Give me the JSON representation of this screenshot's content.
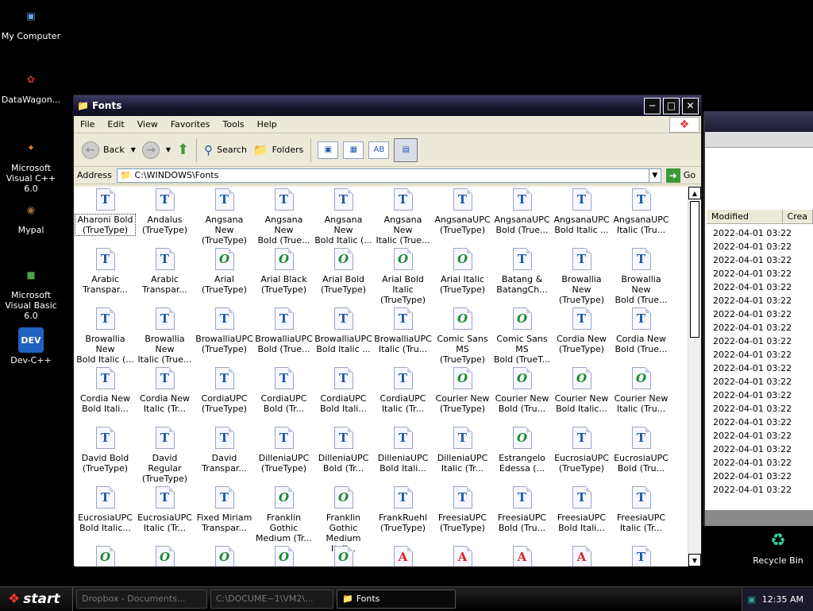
{
  "desktop": {
    "icons": [
      {
        "label": "My Computer",
        "glyph": "▣",
        "color": "#6aa0e0"
      },
      {
        "label": "DataWagon...",
        "glyph": "✿",
        "color": "#c03030"
      },
      {
        "label": "Microsoft Visual C++ 6.0",
        "glyph": "✦",
        "color": "#e08020"
      },
      {
        "label": "Mypal",
        "glyph": "◉",
        "color": "#a07040"
      },
      {
        "label": "Microsoft Visual Basic 6.0",
        "glyph": "■",
        "color": "#4aa04a"
      },
      {
        "label": "Dev-C++",
        "glyph": "DEV",
        "color": "#2060c0"
      }
    ],
    "recycle_bin": "Recycle Bin"
  },
  "background_window": {
    "columns": [
      "Modified",
      "Crea"
    ],
    "rows": [
      "2022-04-01 03:22",
      "2022-04-01 03:22",
      "2022-04-01 03:22",
      "2022-04-01 03:22",
      "2022-04-01 03:22",
      "2022-04-01 03:22",
      "2022-04-01 03:22",
      "2022-04-01 03:22",
      "2022-04-01 03:22",
      "2022-04-01 03:22",
      "2022-04-01 03:22",
      "2022-04-01 03:22",
      "2022-04-01 03:22",
      "2022-04-01 03:22",
      "2022-04-01 03:22",
      "2022-04-01 03:22",
      "2022-04-01 03:22",
      "2022-04-01 03:22",
      "2022-04-01 03:22",
      "2022-04-01 03:22"
    ]
  },
  "window": {
    "title": "Fonts",
    "menu": [
      "File",
      "Edit",
      "View",
      "Favorites",
      "Tools",
      "Help"
    ],
    "toolbar": {
      "back": "Back",
      "search": "Search",
      "folders": "Folders"
    },
    "address": {
      "label": "Address",
      "value": "C:\\WINDOWS\\Fonts",
      "go": "Go"
    }
  },
  "fonts": [
    {
      "l1": "Aharoni Bold",
      "l2": "(TrueType)",
      "type": "T"
    },
    {
      "l1": "Andalus",
      "l2": "(TrueType)",
      "type": "T"
    },
    {
      "l1": "Angsana New",
      "l2": "(TrueType)",
      "type": "T"
    },
    {
      "l1": "Angsana New",
      "l2": "Bold (True...",
      "type": "T"
    },
    {
      "l1": "Angsana New",
      "l2": "Bold Italic (...",
      "type": "T"
    },
    {
      "l1": "Angsana New",
      "l2": "Italic (True...",
      "type": "T"
    },
    {
      "l1": "AngsanaUPC",
      "l2": "(TrueType)",
      "type": "T"
    },
    {
      "l1": "AngsanaUPC",
      "l2": "Bold (True...",
      "type": "T"
    },
    {
      "l1": "AngsanaUPC",
      "l2": "Bold Italic ...",
      "type": "T"
    },
    {
      "l1": "AngsanaUPC",
      "l2": "Italic (Tru...",
      "type": "T"
    },
    {
      "l1": "Arabic",
      "l2": "Transpar...",
      "type": "T"
    },
    {
      "l1": "Arabic",
      "l2": "Transpar...",
      "type": "T"
    },
    {
      "l1": "Arial",
      "l2": "(TrueType)",
      "type": "O"
    },
    {
      "l1": "Arial Black",
      "l2": "(TrueType)",
      "type": "O"
    },
    {
      "l1": "Arial Bold",
      "l2": "(TrueType)",
      "type": "O"
    },
    {
      "l1": "Arial Bold Italic",
      "l2": "(TrueType)",
      "type": "O"
    },
    {
      "l1": "Arial Italic",
      "l2": "(TrueType)",
      "type": "O"
    },
    {
      "l1": "Batang &",
      "l2": "BatangCh...",
      "type": "T"
    },
    {
      "l1": "Browallia New",
      "l2": "(TrueType)",
      "type": "T"
    },
    {
      "l1": "Browallia New",
      "l2": "Bold (True...",
      "type": "T"
    },
    {
      "l1": "Browallia New",
      "l2": "Bold Italic (...",
      "type": "T"
    },
    {
      "l1": "Browallia New",
      "l2": "Italic (True...",
      "type": "T"
    },
    {
      "l1": "BrowalliaUPC",
      "l2": "(TrueType)",
      "type": "T"
    },
    {
      "l1": "BrowalliaUPC",
      "l2": "Bold (True...",
      "type": "T"
    },
    {
      "l1": "BrowalliaUPC",
      "l2": "Bold Italic ...",
      "type": "T"
    },
    {
      "l1": "BrowalliaUPC",
      "l2": "Italic (Tru...",
      "type": "T"
    },
    {
      "l1": "Comic Sans MS",
      "l2": "(TrueType)",
      "type": "O"
    },
    {
      "l1": "Comic Sans MS",
      "l2": "Bold (TrueT...",
      "type": "O"
    },
    {
      "l1": "Cordia New",
      "l2": "(TrueType)",
      "type": "T"
    },
    {
      "l1": "Cordia New",
      "l2": "Bold (True...",
      "type": "T"
    },
    {
      "l1": "Cordia New",
      "l2": "Bold Itali...",
      "type": "T"
    },
    {
      "l1": "Cordia New",
      "l2": "Italic (Tr...",
      "type": "T"
    },
    {
      "l1": "CordiaUPC",
      "l2": "(TrueType)",
      "type": "T"
    },
    {
      "l1": "CordiaUPC",
      "l2": "Bold (Tr...",
      "type": "T"
    },
    {
      "l1": "CordiaUPC",
      "l2": "Bold Itali...",
      "type": "T"
    },
    {
      "l1": "CordiaUPC",
      "l2": "Italic (Tr...",
      "type": "T"
    },
    {
      "l1": "Courier New",
      "l2": "(TrueType)",
      "type": "O"
    },
    {
      "l1": "Courier New",
      "l2": "Bold (Tru...",
      "type": "O"
    },
    {
      "l1": "Courier New",
      "l2": "Bold Italic...",
      "type": "O"
    },
    {
      "l1": "Courier New",
      "l2": "Italic (Tru...",
      "type": "O"
    },
    {
      "l1": "David Bold",
      "l2": "(TrueType)",
      "type": "T"
    },
    {
      "l1": "David Regular",
      "l2": "(TrueType)",
      "type": "T"
    },
    {
      "l1": "David",
      "l2": "Transpar...",
      "type": "T"
    },
    {
      "l1": "DilleniaUPC",
      "l2": "(TrueType)",
      "type": "T"
    },
    {
      "l1": "DilleniaUPC",
      "l2": "Bold (Tr...",
      "type": "T"
    },
    {
      "l1": "DilleniaUPC",
      "l2": "Bold Itali...",
      "type": "T"
    },
    {
      "l1": "DilleniaUPC",
      "l2": "Italic (Tr...",
      "type": "T"
    },
    {
      "l1": "Estrangelo",
      "l2": "Edessa (...",
      "type": "O"
    },
    {
      "l1": "EucrosiaUPC",
      "l2": "(TrueType)",
      "type": "T"
    },
    {
      "l1": "EucrosiaUPC",
      "l2": "Bold (Tru...",
      "type": "T"
    },
    {
      "l1": "EucrosiaUPC",
      "l2": "Bold Italic...",
      "type": "T"
    },
    {
      "l1": "EucrosiaUPC",
      "l2": "Italic (Tr...",
      "type": "T"
    },
    {
      "l1": "Fixed Miriam",
      "l2": "Transpar...",
      "type": "T"
    },
    {
      "l1": "Franklin Gothic",
      "l2": "Medium (Tr...",
      "type": "O"
    },
    {
      "l1": "Franklin Gothic",
      "l2": "Medium Itali...",
      "type": "O"
    },
    {
      "l1": "FrankRuehl",
      "l2": "(TrueType)",
      "type": "T"
    },
    {
      "l1": "FreesiaUPC",
      "l2": "(TrueType)",
      "type": "T"
    },
    {
      "l1": "FreesiaUPC",
      "l2": "Bold (Tru...",
      "type": "T"
    },
    {
      "l1": "FreesiaUPC",
      "l2": "Bold Itali...",
      "type": "T"
    },
    {
      "l1": "FreesiaUPC",
      "l2": "Italic (Tr...",
      "type": "T"
    },
    {
      "l1": "",
      "l2": "",
      "type": "O"
    },
    {
      "l1": "",
      "l2": "",
      "type": "O"
    },
    {
      "l1": "",
      "l2": "",
      "type": "O"
    },
    {
      "l1": "",
      "l2": "",
      "type": "O"
    },
    {
      "l1": "",
      "l2": "",
      "type": "O"
    },
    {
      "l1": "",
      "l2": "",
      "type": "A"
    },
    {
      "l1": "",
      "l2": "",
      "type": "A"
    },
    {
      "l1": "",
      "l2": "",
      "type": "A"
    },
    {
      "l1": "",
      "l2": "",
      "type": "A"
    },
    {
      "l1": "",
      "l2": "",
      "type": "T"
    }
  ],
  "taskbar": {
    "start": "start",
    "tasks": [
      "Dropbox - Documents...",
      "C:\\DOCUME~1\\VM2\\...",
      "Fonts"
    ],
    "clock": "12:35 AM"
  }
}
